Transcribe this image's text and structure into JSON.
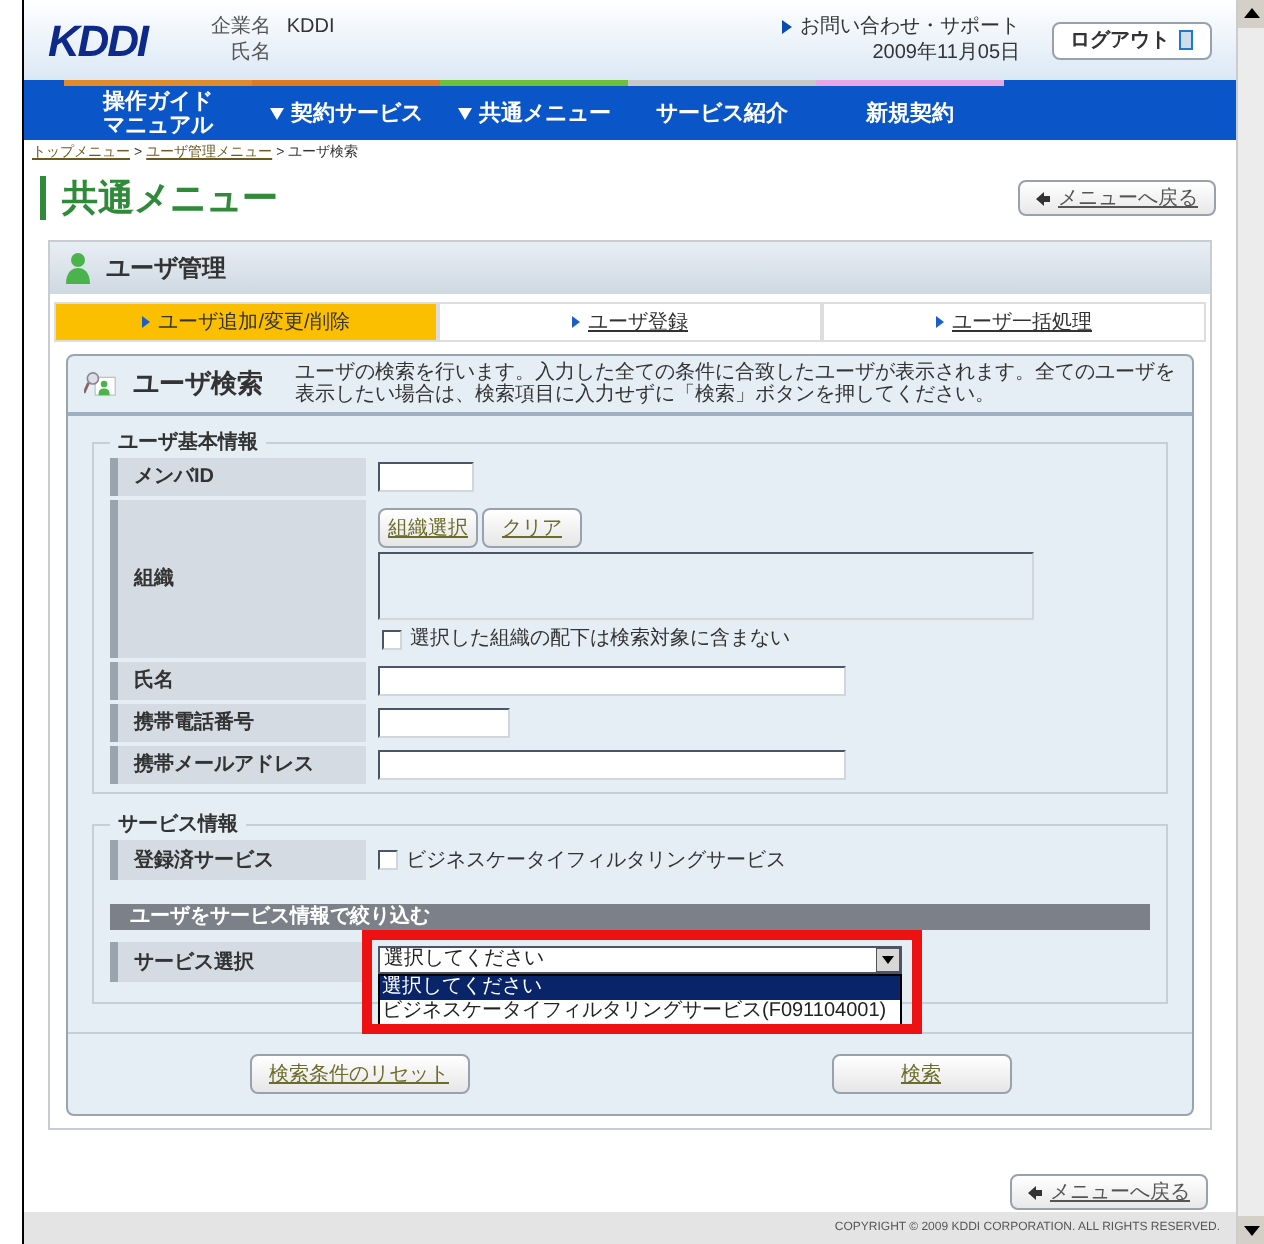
{
  "header": {
    "logo": "KDDI",
    "company_label": "企業名",
    "company": "KDDI",
    "name_label": "氏名",
    "support_link": "お問い合わせ・サポート",
    "date": "2009年11月05日",
    "logout": "ログアウト"
  },
  "nav": [
    {
      "lines": [
        "操作ガイド",
        "マニュアル"
      ],
      "has_menu": false,
      "color": "#e08a2a"
    },
    {
      "lines": [
        "契約サービス"
      ],
      "has_menu": true,
      "color": "#e07a20"
    },
    {
      "lines": [
        "共通メニュー"
      ],
      "has_menu": true,
      "color": "#6cc03a"
    },
    {
      "lines": [
        "サービス紹介"
      ],
      "has_menu": false,
      "color": "#c8c8c8"
    },
    {
      "lines": [
        "新規契約"
      ],
      "has_menu": false,
      "color": "#e8a8e8"
    }
  ],
  "breadcrumb": {
    "separator": ">",
    "items": [
      {
        "label": "トップメニュー",
        "link": true
      },
      {
        "label": "ユーザ管理メニュー",
        "link": true
      },
      {
        "label": "ユーザ検索",
        "link": false
      }
    ]
  },
  "page_title": "共通メニュー",
  "back_link": "メニューへ戻る",
  "section": {
    "title": "ユーザ管理",
    "tabs": [
      {
        "label": "ユーザ追加/変更/削除",
        "selected": true
      },
      {
        "label": "ユーザ登録",
        "selected": false
      },
      {
        "label": "ユーザ一括処理",
        "selected": false
      }
    ]
  },
  "search_panel": {
    "title": "ユーザ検索",
    "description": "ユーザの検索を行います。入力した全ての条件に合致したユーザが表示されます。全てのユーザを表示したい場合は、検索項目に入力せずに「検索」ボタンを押してください。"
  },
  "basic_info": {
    "legend": "ユーザ基本情報",
    "fields": [
      {
        "kind": "short",
        "label": "メンバID"
      },
      {
        "kind": "org",
        "label": "組織",
        "buttons": [
          "組織選択",
          "クリア"
        ],
        "checkbox": {
          "label": "選択した組織の配下は検索対象に含まない",
          "checked": false
        }
      },
      {
        "kind": "long",
        "label": "氏名"
      },
      {
        "kind": "medium",
        "label": "携帯電話番号"
      },
      {
        "kind": "long",
        "label": "携帯メールアドレス"
      }
    ]
  },
  "service_info": {
    "legend": "サービス情報",
    "registered": {
      "label": "登録済サービス",
      "checkbox": {
        "label": "ビジネスケータイフィルタリングサービス",
        "checked": false
      }
    },
    "filter_heading": "ユーザをサービス情報で絞り込む",
    "select": {
      "label": "サービス選択",
      "value": "選択してください",
      "expanded": true,
      "highlighted": true,
      "options": [
        {
          "label": "選択してください",
          "selected": true
        },
        {
          "label": "ビジネスケータイフィルタリングサービス(F091104001)",
          "selected": false
        }
      ]
    }
  },
  "buttons": [
    "検索条件のリセット",
    "検索"
  ],
  "back_link_bottom": "メニューへ戻る",
  "copyright": "COPYRIGHT © 2009 KDDI CORPORATION. ALL RIGHTS RESERVED."
}
